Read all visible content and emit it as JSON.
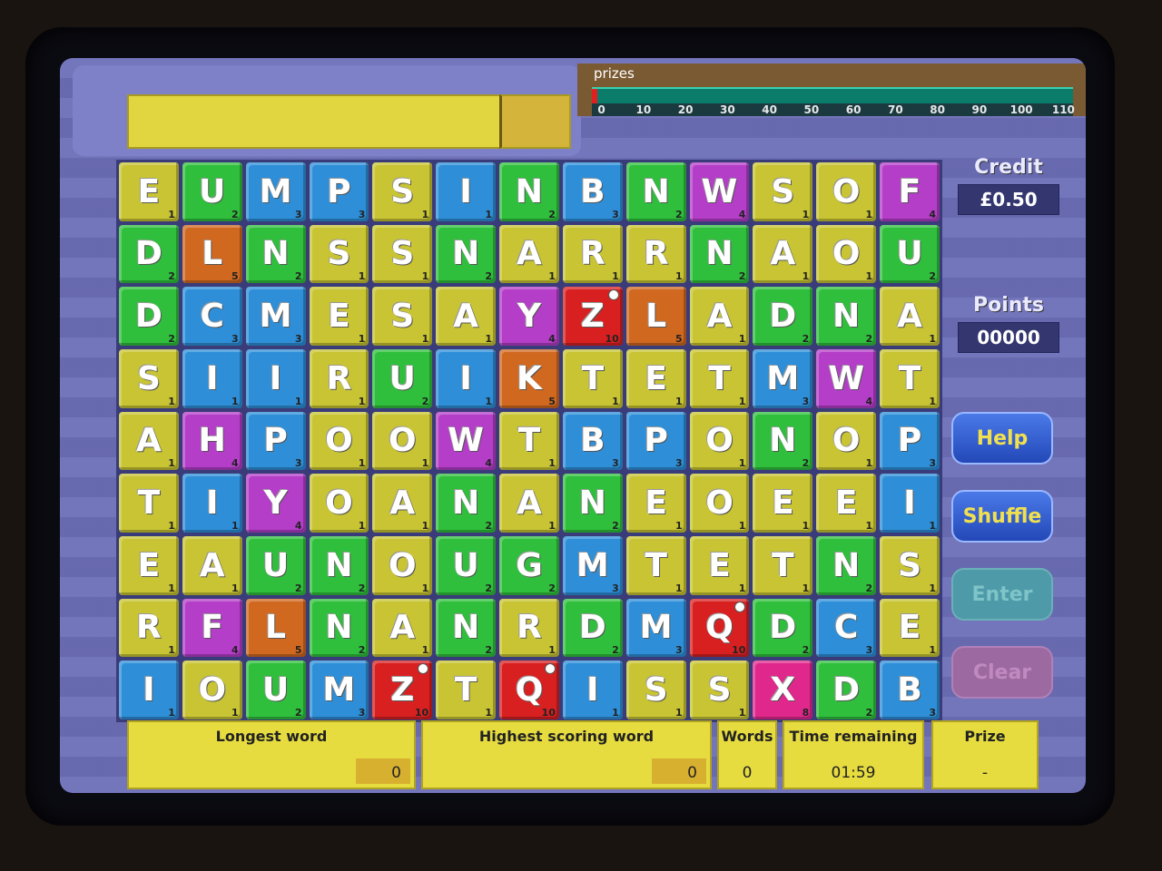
{
  "prizes": {
    "label": "prizes",
    "ticks": [
      "0",
      "10",
      "20",
      "30",
      "40",
      "50",
      "60",
      "70",
      "80",
      "90",
      "100",
      "110"
    ],
    "progress": 0
  },
  "sidebar": {
    "credit_label": "Credit",
    "credit_value": "£0.50",
    "points_label": "Points",
    "points_value": "00000"
  },
  "buttons": {
    "help": "Help",
    "shuffle": "Shuffle",
    "enter": "Enter",
    "clear": "Clear"
  },
  "stats": {
    "longest_word_label": "Longest word",
    "longest_word_value": "0",
    "highest_scoring_label": "Highest scoring word",
    "highest_scoring_value": "0",
    "words_label": "Words",
    "words_value": "0",
    "time_label": "Time remaining",
    "time_value": "01:59",
    "prize_label": "Prize",
    "prize_value": "-"
  },
  "colors": {
    "yellow": "#c8c433",
    "green": "#2fbf3c",
    "blue": "#2e8fd8",
    "purple": "#b43ec8",
    "orange": "#d06820",
    "red": "#d82020",
    "pink": "#e0288c"
  },
  "grid": [
    [
      [
        "E",
        1,
        "yellow"
      ],
      [
        "U",
        2,
        "green"
      ],
      [
        "M",
        3,
        "blue"
      ],
      [
        "P",
        3,
        "blue"
      ],
      [
        "S",
        1,
        "yellow"
      ],
      [
        "I",
        1,
        "blue"
      ],
      [
        "N",
        2,
        "green"
      ],
      [
        "B",
        3,
        "blue"
      ],
      [
        "N",
        2,
        "green"
      ],
      [
        "W",
        4,
        "purple"
      ],
      [
        "S",
        1,
        "yellow"
      ],
      [
        "O",
        1,
        "yellow"
      ],
      [
        "F",
        4,
        "purple"
      ]
    ],
    [
      [
        "D",
        2,
        "green"
      ],
      [
        "L",
        5,
        "orange"
      ],
      [
        "N",
        2,
        "green"
      ],
      [
        "S",
        1,
        "yellow"
      ],
      [
        "S",
        1,
        "yellow"
      ],
      [
        "N",
        2,
        "green"
      ],
      [
        "A",
        1,
        "yellow"
      ],
      [
        "R",
        1,
        "yellow"
      ],
      [
        "R",
        1,
        "yellow"
      ],
      [
        "N",
        2,
        "green"
      ],
      [
        "A",
        1,
        "yellow"
      ],
      [
        "O",
        1,
        "yellow"
      ],
      [
        "U",
        2,
        "green"
      ]
    ],
    [
      [
        "D",
        2,
        "green"
      ],
      [
        "C",
        3,
        "blue"
      ],
      [
        "M",
        3,
        "blue"
      ],
      [
        "E",
        1,
        "yellow"
      ],
      [
        "S",
        1,
        "yellow"
      ],
      [
        "A",
        1,
        "yellow"
      ],
      [
        "Y",
        4,
        "purple"
      ],
      [
        "Z",
        10,
        "red"
      ],
      [
        "L",
        5,
        "orange"
      ],
      [
        "A",
        1,
        "yellow"
      ],
      [
        "D",
        2,
        "green"
      ],
      [
        "N",
        2,
        "green"
      ],
      [
        "A",
        1,
        "yellow"
      ]
    ],
    [
      [
        "S",
        1,
        "yellow"
      ],
      [
        "I",
        1,
        "blue"
      ],
      [
        "I",
        1,
        "blue"
      ],
      [
        "R",
        1,
        "yellow"
      ],
      [
        "U",
        2,
        "green"
      ],
      [
        "I",
        1,
        "blue"
      ],
      [
        "K",
        5,
        "orange"
      ],
      [
        "T",
        1,
        "yellow"
      ],
      [
        "E",
        1,
        "yellow"
      ],
      [
        "T",
        1,
        "yellow"
      ],
      [
        "M",
        3,
        "blue"
      ],
      [
        "W",
        4,
        "purple"
      ],
      [
        "T",
        1,
        "yellow"
      ]
    ],
    [
      [
        "A",
        1,
        "yellow"
      ],
      [
        "H",
        4,
        "purple"
      ],
      [
        "P",
        3,
        "blue"
      ],
      [
        "O",
        1,
        "yellow"
      ],
      [
        "O",
        1,
        "yellow"
      ],
      [
        "W",
        4,
        "purple"
      ],
      [
        "T",
        1,
        "yellow"
      ],
      [
        "B",
        3,
        "blue"
      ],
      [
        "P",
        3,
        "blue"
      ],
      [
        "O",
        1,
        "yellow"
      ],
      [
        "N",
        2,
        "green"
      ],
      [
        "O",
        1,
        "yellow"
      ],
      [
        "P",
        3,
        "blue"
      ]
    ],
    [
      [
        "T",
        1,
        "yellow"
      ],
      [
        "I",
        1,
        "blue"
      ],
      [
        "Y",
        4,
        "purple"
      ],
      [
        "O",
        1,
        "yellow"
      ],
      [
        "A",
        1,
        "yellow"
      ],
      [
        "N",
        2,
        "green"
      ],
      [
        "A",
        1,
        "yellow"
      ],
      [
        "N",
        2,
        "green"
      ],
      [
        "E",
        1,
        "yellow"
      ],
      [
        "O",
        1,
        "yellow"
      ],
      [
        "E",
        1,
        "yellow"
      ],
      [
        "E",
        1,
        "yellow"
      ],
      [
        "I",
        1,
        "blue"
      ]
    ],
    [
      [
        "E",
        1,
        "yellow"
      ],
      [
        "A",
        1,
        "yellow"
      ],
      [
        "U",
        2,
        "green"
      ],
      [
        "N",
        2,
        "green"
      ],
      [
        "O",
        1,
        "yellow"
      ],
      [
        "U",
        2,
        "green"
      ],
      [
        "G",
        2,
        "green"
      ],
      [
        "M",
        3,
        "blue"
      ],
      [
        "T",
        1,
        "yellow"
      ],
      [
        "E",
        1,
        "yellow"
      ],
      [
        "T",
        1,
        "yellow"
      ],
      [
        "N",
        2,
        "green"
      ],
      [
        "S",
        1,
        "yellow"
      ]
    ],
    [
      [
        "R",
        1,
        "yellow"
      ],
      [
        "F",
        4,
        "purple"
      ],
      [
        "L",
        5,
        "orange"
      ],
      [
        "N",
        2,
        "green"
      ],
      [
        "A",
        1,
        "yellow"
      ],
      [
        "N",
        2,
        "green"
      ],
      [
        "R",
        1,
        "yellow"
      ],
      [
        "D",
        2,
        "green"
      ],
      [
        "M",
        3,
        "blue"
      ],
      [
        "Q",
        10,
        "red"
      ],
      [
        "D",
        2,
        "green"
      ],
      [
        "C",
        3,
        "blue"
      ],
      [
        "E",
        1,
        "yellow"
      ]
    ],
    [
      [
        "I",
        1,
        "blue"
      ],
      [
        "O",
        1,
        "yellow"
      ],
      [
        "U",
        2,
        "green"
      ],
      [
        "M",
        3,
        "blue"
      ],
      [
        "Z",
        10,
        "red"
      ],
      [
        "T",
        1,
        "yellow"
      ],
      [
        "Q",
        10,
        "red"
      ],
      [
        "I",
        1,
        "blue"
      ],
      [
        "S",
        1,
        "yellow"
      ],
      [
        "S",
        1,
        "yellow"
      ],
      [
        "X",
        8,
        "pink"
      ],
      [
        "D",
        2,
        "green"
      ],
      [
        "B",
        3,
        "blue"
      ]
    ]
  ]
}
